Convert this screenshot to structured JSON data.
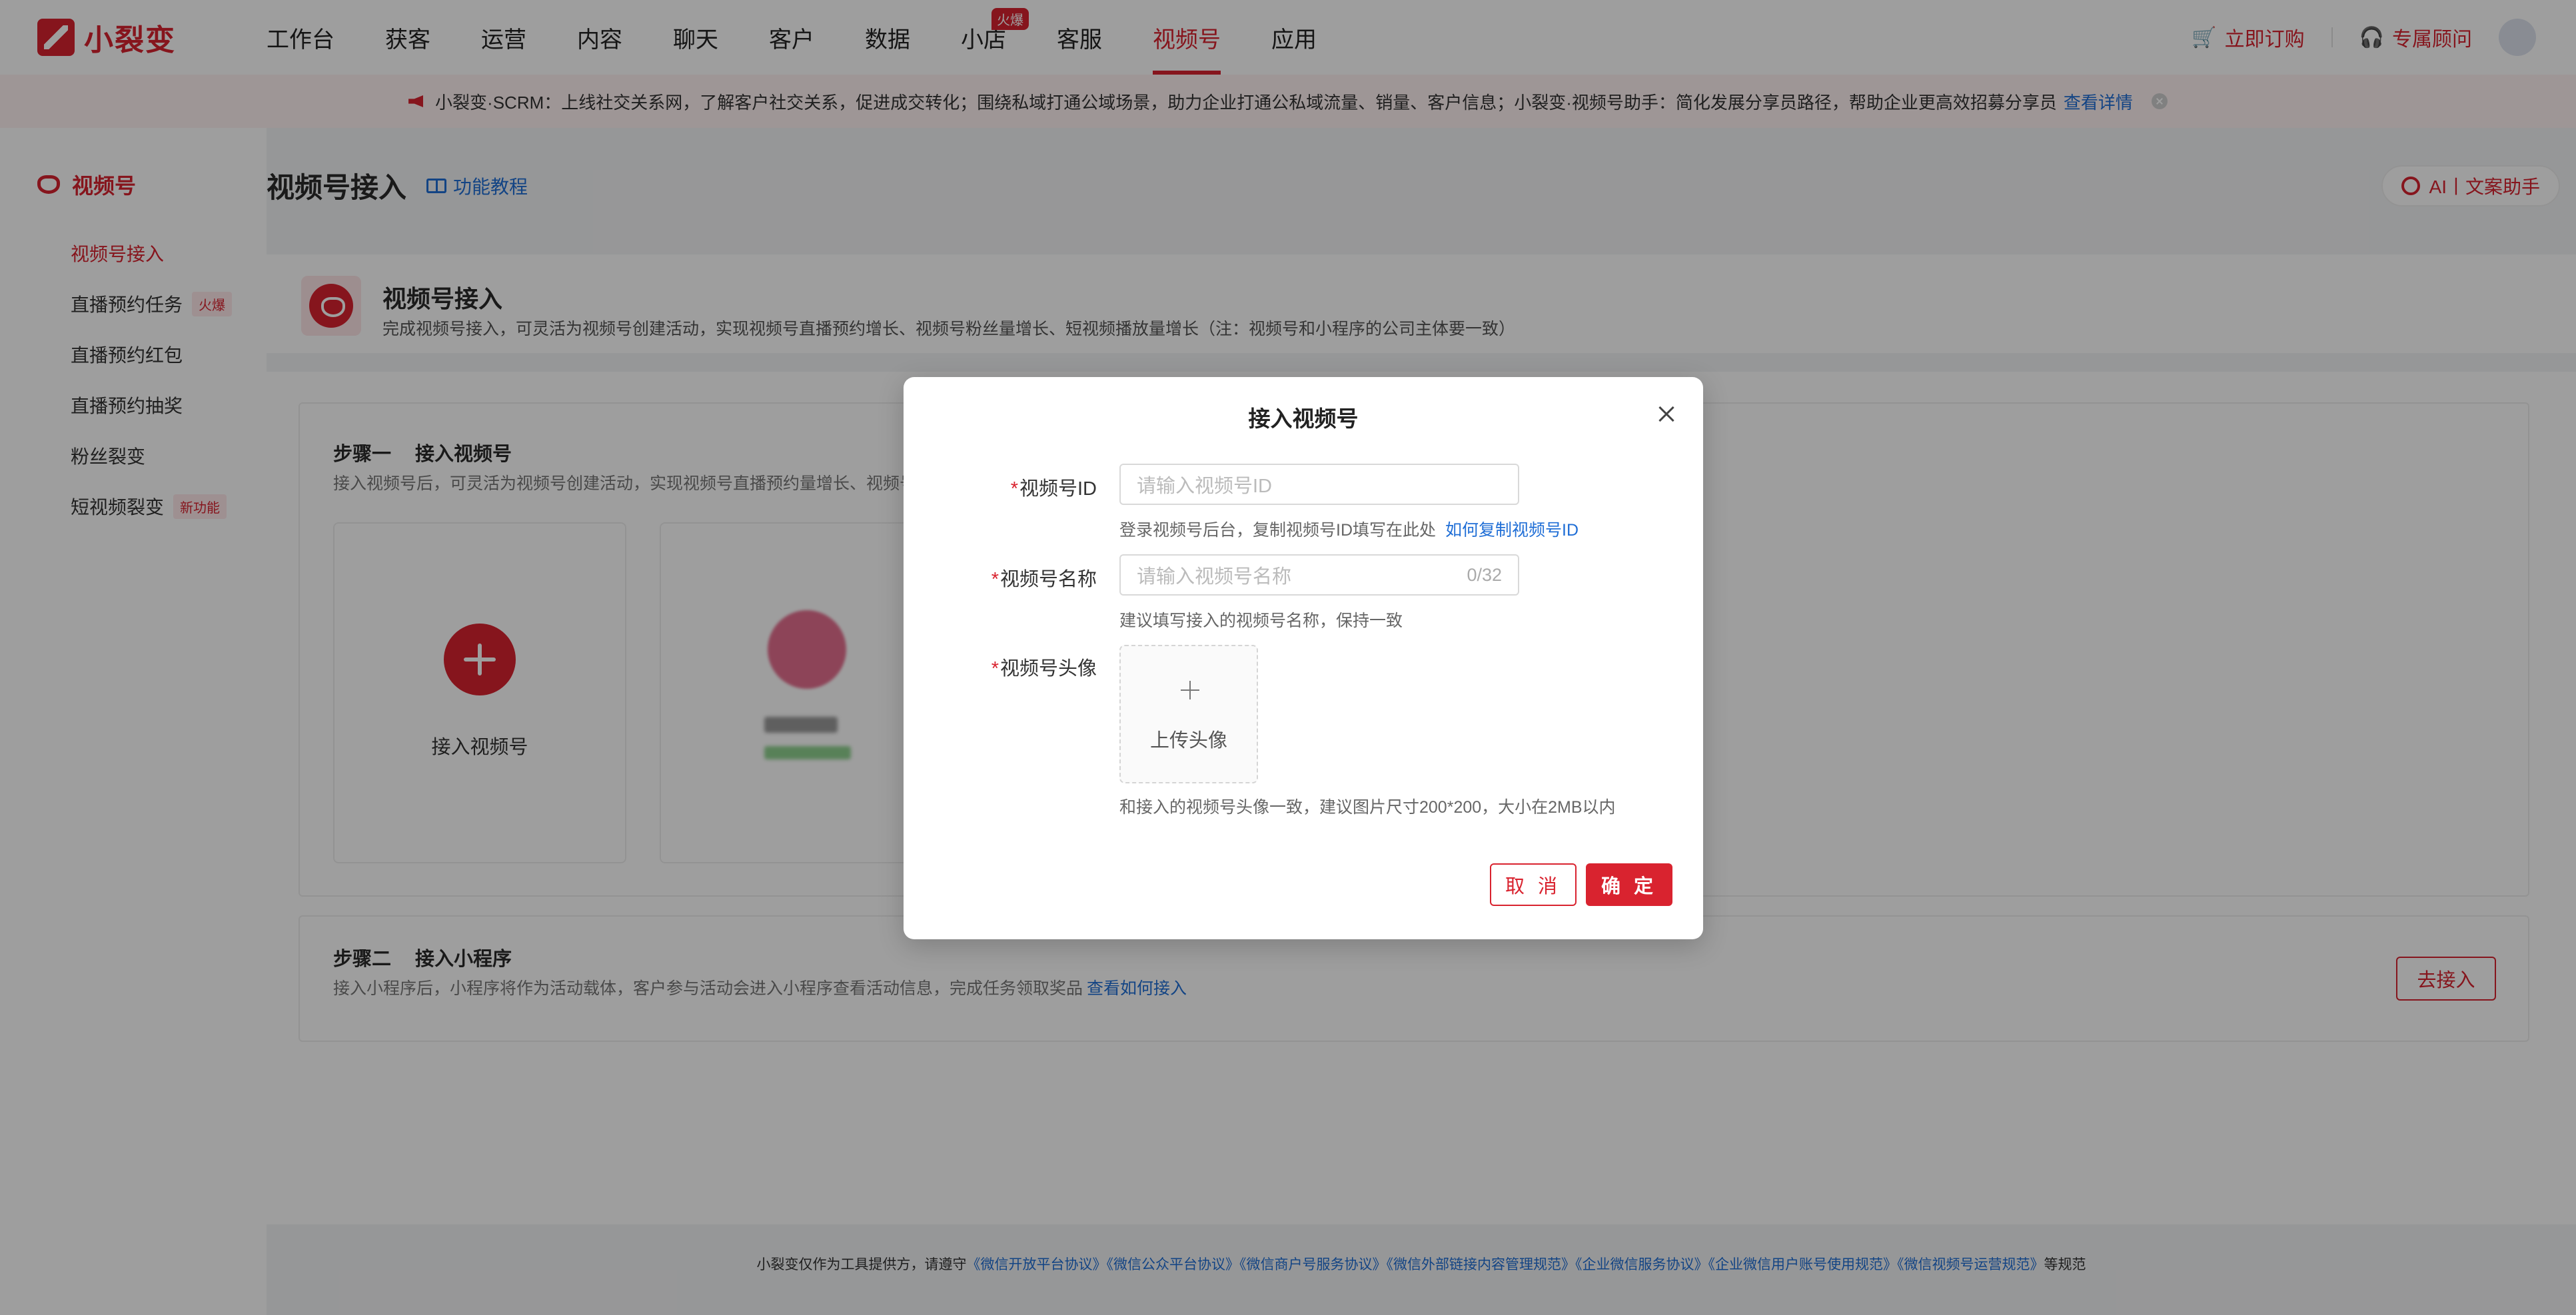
{
  "brand": {
    "name": "小裂变",
    "color": "#d9232f"
  },
  "nav": {
    "items": [
      {
        "label": "工作台"
      },
      {
        "label": "获客"
      },
      {
        "label": "运营"
      },
      {
        "label": "内容"
      },
      {
        "label": "聊天"
      },
      {
        "label": "客户"
      },
      {
        "label": "数据"
      },
      {
        "label": "小店",
        "badge": "火爆"
      },
      {
        "label": "客服"
      },
      {
        "label": "视频号",
        "active": true
      },
      {
        "label": "应用"
      }
    ],
    "right": {
      "order": "立即订购",
      "advisor": "专属顾问"
    }
  },
  "notice": {
    "text": "小裂变·SCRM：上线社交关系网，了解客户社交关系，促进成交转化；围绕私域打通公域场景，助力企业打通公私域流量、销量、客户信息；小裂变·视频号助手：简化发展分享员路径，帮助企业更高效招募分享员",
    "link": "查看详情"
  },
  "sidebar": {
    "title": "视频号",
    "items": [
      {
        "label": "视频号接入",
        "active": true
      },
      {
        "label": "直播预约任务",
        "tag": "火爆"
      },
      {
        "label": "直播预约红包"
      },
      {
        "label": "直播预约抽奖"
      },
      {
        "label": "粉丝裂变"
      },
      {
        "label": "短视频裂变",
        "tag": "新功能"
      }
    ]
  },
  "page": {
    "title": "视频号接入",
    "tutorial": "功能教程",
    "ai_assistant": "AI丨文案助手"
  },
  "intro": {
    "title": "视频号接入",
    "desc": "完成视频号接入，可灵活为视频号创建活动，实现视频号直播预约增长、视频号粉丝量增长、短视频播放量增长（注：视频号和小程序的公司主体要一致）"
  },
  "step1": {
    "index": "步骤一",
    "title": "接入视频号",
    "desc": "接入视频号后，可灵活为视频号创建活动，实现视频号直播预约量增长、视频号粉",
    "add_label": "接入视频号"
  },
  "step2": {
    "index": "步骤二",
    "title": "接入小程序",
    "desc": "接入小程序后，小程序将作为活动载体，客户参与活动会进入小程序查看活动信息，完成任务领取奖品",
    "link": "查看如何接入",
    "button": "去接入"
  },
  "footer": {
    "prefix": "小裂变仅作为工具提供方，请遵守",
    "links": [
      "《微信开放平台协议》",
      "《微信公众平台协议》",
      "《微信商户号服务协议》",
      "《微信外部链接内容管理规范》",
      "《企业微信服务协议》",
      "《企业微信用户账号使用规范》",
      "《微信视频号运营规范》"
    ],
    "suffix": "等规范"
  },
  "modal": {
    "title": "接入视频号",
    "id_field": {
      "label": "视频号ID",
      "placeholder": "请输入视频号ID",
      "hint": "登录视频号后台，复制视频号ID填写在此处",
      "hint_link": "如何复制视频号ID"
    },
    "name_field": {
      "label": "视频号名称",
      "placeholder": "请输入视频号名称",
      "count": "0/32",
      "hint": "建议填写接入的视频号名称，保持一致"
    },
    "avatar_field": {
      "label": "视频号头像",
      "upload": "上传头像",
      "hint": "和接入的视频号头像一致，建议图片尺寸200*200，大小在2MB以内"
    },
    "cancel": "取 消",
    "confirm": "确 定"
  }
}
